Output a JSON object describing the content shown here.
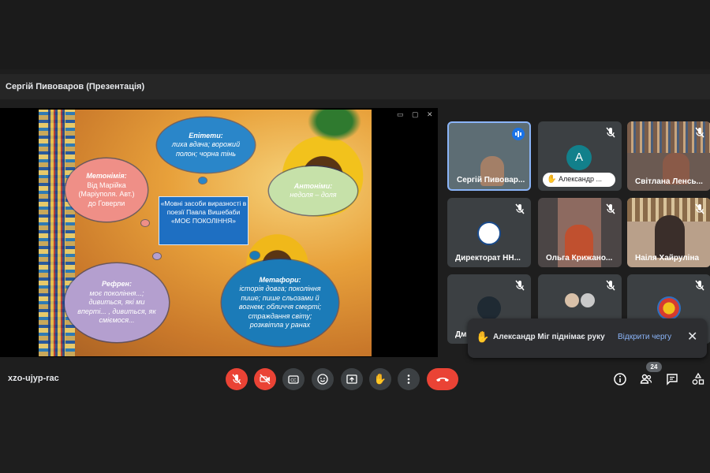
{
  "header": {
    "presenter_title": "Сергій Пивоваров (Презентація)"
  },
  "slide": {
    "epithets": {
      "title": "Епітети:",
      "body": "лихa вдача; ворожий полон; чорна тінь"
    },
    "metonymy": {
      "title": "Метонімія:",
      "body": "Від Марійка (Маріуполя. Авт.) до Говерли"
    },
    "antonyms": {
      "title": "Антоніми:",
      "body": "недоля – доля"
    },
    "center": {
      "text": "«Мовні засоби виразності в поезії Павла Вишебаби «МОЄ ПОКОЛІННЯ»"
    },
    "refrain": {
      "title": "Рефрен:",
      "body": "моє покоління...; дивиться, які ми вперті... , дивиться, як сміємося..."
    },
    "metaphors": {
      "title": "Метафори:",
      "body": "історія довга; покоління пише; пише сльозами й вогнем; обличчя смерті; страждання світу; розквітла у ранах"
    }
  },
  "participants": [
    {
      "name": "Сергій Пивовар...",
      "icon": "speaking-icon"
    },
    {
      "name": "Александр ...",
      "avatar_letter": "A",
      "avatar_color": "#12808b",
      "icon": "mic-off-icon"
    },
    {
      "name": "Світлана Ленсь...",
      "icon": "mic-off-icon"
    },
    {
      "name": "Директорат НН...",
      "icon": "mic-off-icon"
    },
    {
      "name": "Ольга Крижано...",
      "icon": "mic-off-icon"
    },
    {
      "name": "Наіля Хайруліна",
      "icon": "mic-off-icon"
    },
    {
      "name": "Дм",
      "icon": "mic-off-icon"
    }
  ],
  "notification": {
    "message": "Александр Міг піднімає руку",
    "action": "Відкрити чергу"
  },
  "bottombar": {
    "meeting_code": "xzo-ujyp-rac",
    "participant_count": "24"
  },
  "colors": {
    "accent": "#8ab4f8",
    "danger": "#ea4335",
    "tile_bg": "#3c4043"
  }
}
